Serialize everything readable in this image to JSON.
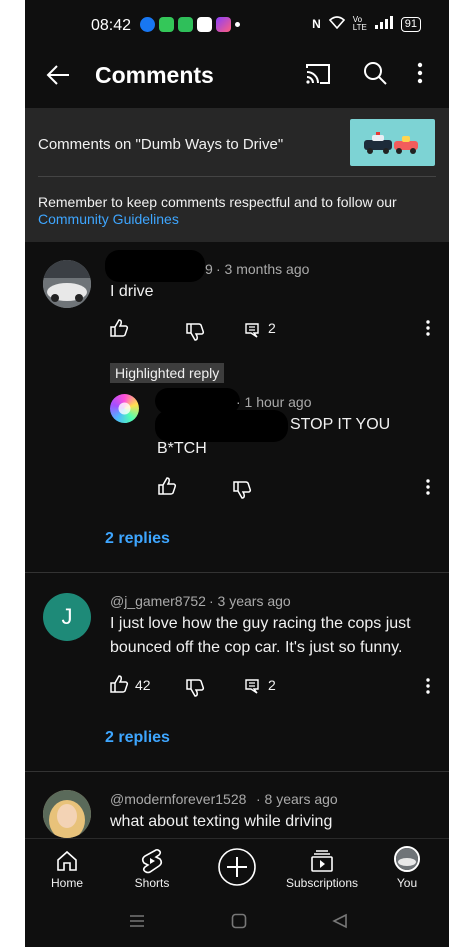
{
  "status_bar": {
    "time": "08:42",
    "network": "Vo LTE",
    "battery": "91"
  },
  "app_bar": {
    "title": "Comments"
  },
  "header": {
    "comments_on": "Comments on \"Dumb Ways to Drive\"",
    "reminder": "Remember to keep comments respectful and to follow our",
    "guidelines_link": "Community Guidelines"
  },
  "comments": [
    {
      "handle_suffix": "9",
      "time": "· 3 months ago",
      "text": "I drive",
      "likes": "",
      "reply_count": "2",
      "highlighted_label": "Highlighted reply",
      "reply": {
        "time": "· 1 hour ago",
        "text_line1": "STOP IT YOU",
        "text_line2": "B*TCH"
      },
      "replies_link": "2 replies"
    },
    {
      "avatar_letter": "J",
      "handle": "@j_gamer8752",
      "time": "· 3 years ago",
      "text_line1": "I just love how the guy racing the cops just",
      "text_line2": "bounced off the cop car. It's just so funny.",
      "likes": "42",
      "reply_count": "2",
      "replies_link": "2 replies"
    },
    {
      "handle": "@modernforever1528",
      "time": "· 8 years ago",
      "text": "what about texting while driving"
    }
  ],
  "bottom_nav": {
    "home": "Home",
    "shorts": "Shorts",
    "subscriptions": "Subscriptions",
    "you": "You"
  },
  "colors": {
    "background": "#0f0f0f",
    "panel": "#272727",
    "link": "#3ea6ff",
    "avatar_j": "#1e8a78"
  }
}
